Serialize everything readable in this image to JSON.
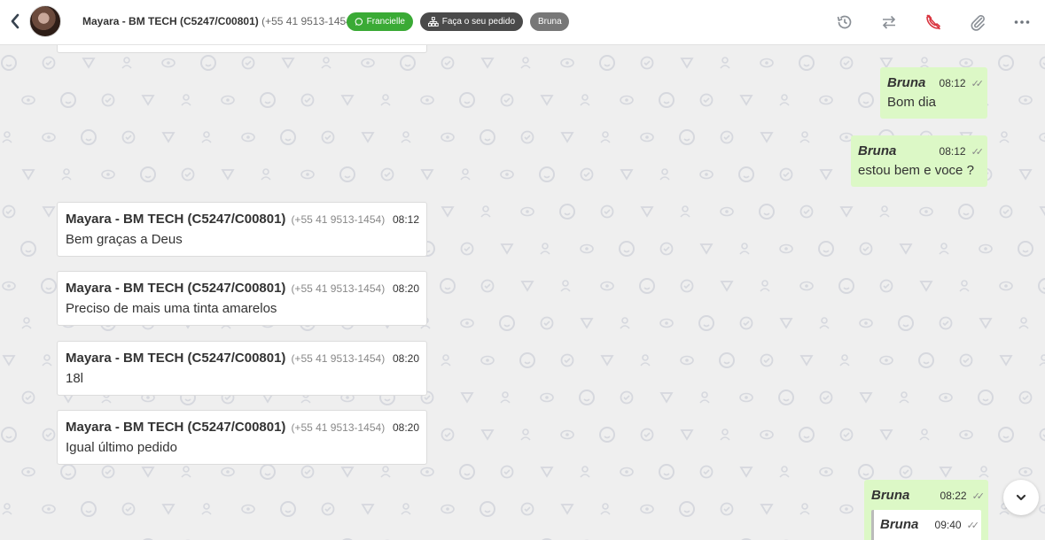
{
  "header": {
    "back_icon": "chevron-left-icon",
    "contact_name": "Mayara - BM TECH (C5247/C00801)",
    "contact_phone": "(+55 41 9513-1454)",
    "tags": [
      {
        "label": "Francielle",
        "color": "#3aaa35",
        "icon": "whatsapp-icon"
      },
      {
        "label": "Faça o seu pedido",
        "color": "#4a4a4a",
        "icon": "sitemap-icon"
      },
      {
        "label": "Bruna",
        "color": "#777777"
      }
    ],
    "actions": [
      "history-icon",
      "transfer-icon",
      "end-call-icon",
      "attach-icon",
      "more-icon"
    ]
  },
  "messages_outgoing": [
    {
      "sender": "Bruna",
      "time": "08:12",
      "text": "Bom dia"
    },
    {
      "sender": "Bruna",
      "time": "08:12",
      "text": "estou bem e voce ?"
    },
    {
      "sender": "Bruna",
      "time": "08:22",
      "text": ""
    }
  ],
  "quoted": {
    "sender": "Bruna",
    "time": "09:40"
  },
  "messages_incoming": [
    {
      "sender": "Mayara - BM TECH (C5247/C00801)",
      "phone": "(+55 41 9513-1454)",
      "time": "08:12",
      "text": "Bem graças a Deus"
    },
    {
      "sender": "Mayara - BM TECH (C5247/C00801)",
      "phone": "(+55 41 9513-1454)",
      "time": "08:20",
      "text": "Preciso de mais uma tinta amarelos"
    },
    {
      "sender": "Mayara - BM TECH (C5247/C00801)",
      "phone": "(+55 41 9513-1454)",
      "time": "08:20",
      "text": "18l"
    },
    {
      "sender": "Mayara - BM TECH (C5247/C00801)",
      "phone": "(+55 41 9513-1454)",
      "time": "08:20",
      "text": "Igual último pedido"
    }
  ],
  "colors": {
    "outgoing_bubble": "#dcf8c6",
    "incoming_bubble": "#ffffff",
    "background": "#efefef",
    "end_call": "#d9343f"
  }
}
